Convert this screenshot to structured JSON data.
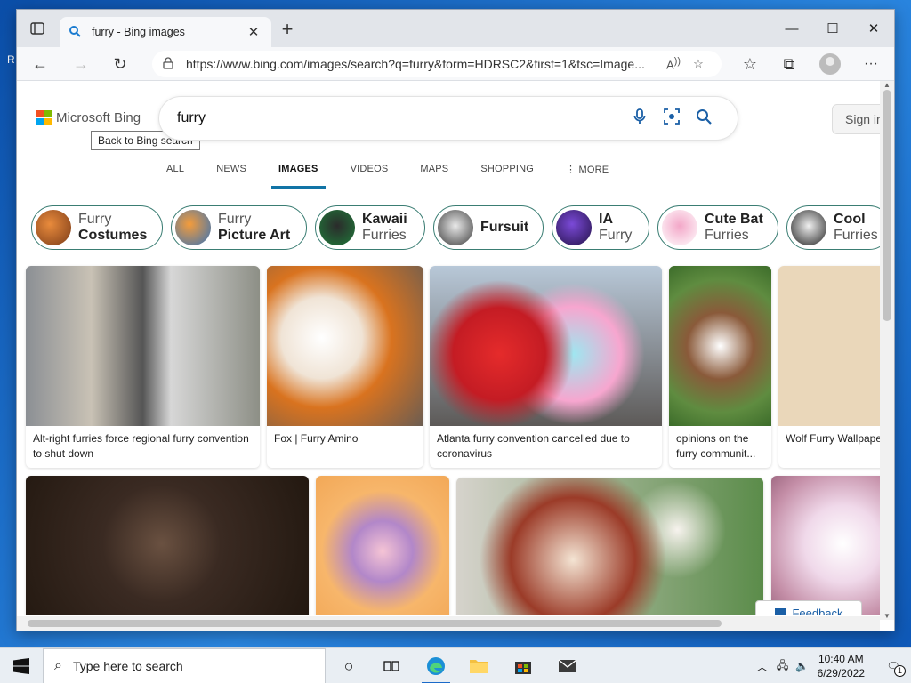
{
  "desktop": {
    "edge_label": "R"
  },
  "browser": {
    "tab": {
      "title": "furry - Bing images",
      "close": "✕"
    },
    "new_tab": "+",
    "window_controls": {
      "minimize": "—",
      "maximize": "☐",
      "close": "✕"
    },
    "url": "https://www.bing.com/images/search?q=furry&form=HDRSC2&first=1&tsc=Image...",
    "read_aloud": "A)",
    "more": "···"
  },
  "bing": {
    "logo_text": "Microsoft Bing",
    "tooltip": "Back to Bing search",
    "query": "furry",
    "signin": "Sign in",
    "nav": [
      "ALL",
      "NEWS",
      "IMAGES",
      "VIDEOS",
      "MAPS",
      "SHOPPING",
      "MORE"
    ],
    "chips": [
      {
        "line1": "Furry",
        "line2": "Costumes"
      },
      {
        "line1": "Furry",
        "line2": "Picture Art"
      },
      {
        "line1": "Kawaii",
        "line2": "Furries"
      },
      {
        "line1": "Fursuit",
        "line2": ""
      },
      {
        "line1": "IA",
        "line2": "Furry"
      },
      {
        "line1": "Cute Bat",
        "line2": "Furries"
      },
      {
        "line1": "Cool",
        "line2": "Furries"
      }
    ],
    "results_row1": [
      {
        "caption": "Alt-right furries force regional furry convention to shut down"
      },
      {
        "caption": "Fox | Furry Amino"
      },
      {
        "caption": "Atlanta furry convention cancelled due to coronavirus"
      },
      {
        "caption": "opinions on the furry communit..."
      },
      {
        "caption": "Wolf Furry Wallpape"
      }
    ],
    "feedback": "Feedback"
  },
  "taskbar": {
    "search_placeholder": "Type here to search",
    "time": "10:40 AM",
    "date": "6/29/2022",
    "notif_count": "1"
  },
  "colors": {
    "accent": "#1174a6",
    "chip_border": "#3a7d73",
    "taskbar": "#e9eef3"
  }
}
